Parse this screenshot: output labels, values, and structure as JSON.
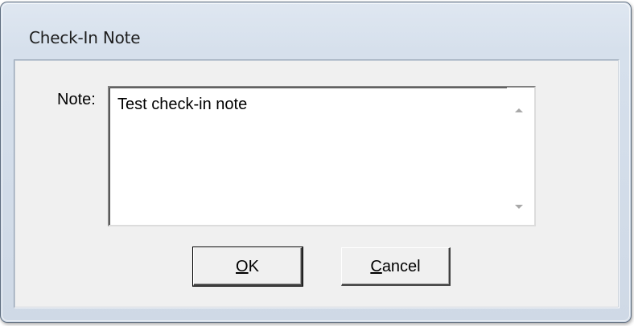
{
  "window": {
    "title": "Check-In Note"
  },
  "form": {
    "note_label": "Note:",
    "note_value": "Test check-in note"
  },
  "buttons": {
    "ok": {
      "mnemonic": "O",
      "rest": "K"
    },
    "cancel": {
      "mnemonic": "C",
      "rest": "ancel"
    }
  },
  "icons": {
    "scroll_up": "scroll-up-arrow-icon",
    "scroll_down": "scroll-down-arrow-icon"
  }
}
